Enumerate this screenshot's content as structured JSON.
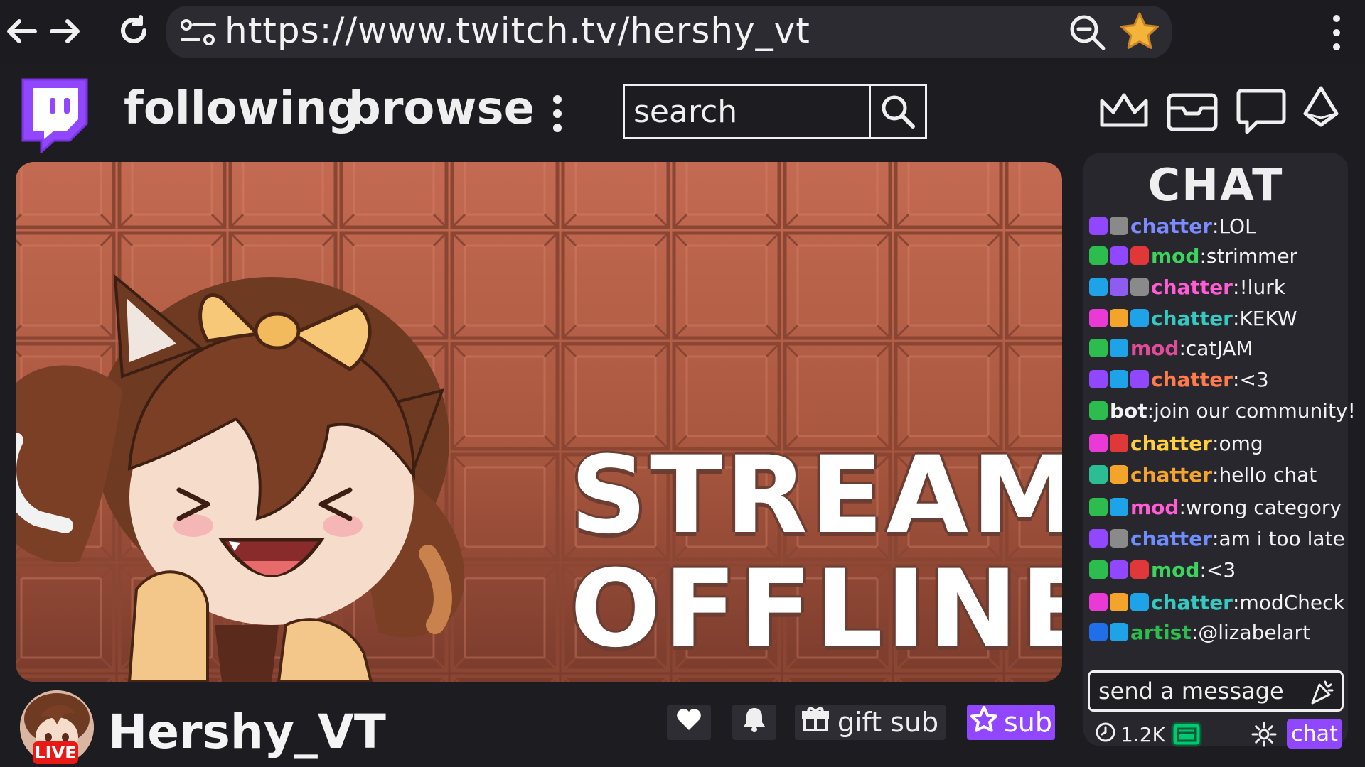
{
  "browser": {
    "url": "https://www.twitch.tv/hershy_vt",
    "icons": [
      "back-icon",
      "forward-icon",
      "reload-icon",
      "site-settings-icon",
      "zoom-out-icon",
      "bookmark-star-icon",
      "browser-menu-icon"
    ],
    "star_color": "#f4b43a"
  },
  "header": {
    "nav": [
      "following",
      "browse"
    ],
    "search_placeholder": "search",
    "icons": [
      "crown-icon",
      "inbox-icon",
      "whispers-icon",
      "bits-icon"
    ],
    "brand_color": "#9146ff"
  },
  "player": {
    "status_line1": "STREAM",
    "status_line2": "OFFLINE"
  },
  "channel": {
    "name": "Hershy_VT",
    "live_badge": "LIVE",
    "gift_label": "gift sub",
    "sub_label": "sub"
  },
  "chat": {
    "title": "CHAT",
    "messages": [
      {
        "badges": [
          "#9146ff",
          "#8a8a8a"
        ],
        "name": "chatter",
        "color": "#7c8cff",
        "text": "LOL"
      },
      {
        "badges": [
          "#2dbd4e",
          "#9146ff",
          "#e03838"
        ],
        "name": "mod",
        "color": "#3dd45e",
        "text": "strimmer"
      },
      {
        "badges": [
          "#1fa3e8",
          "#8e5cf0",
          "#8a8a8a"
        ],
        "name": "chatter",
        "color": "#ff5cd6",
        "text": "!lurk"
      },
      {
        "badges": [
          "#e93ad6",
          "#f4a32b",
          "#1fa3e8"
        ],
        "name": "chatter",
        "color": "#35c9c2",
        "text": "KEKW"
      },
      {
        "badges": [
          "#2dbd4e",
          "#1fa3e8"
        ],
        "name": "mod",
        "color": "#e04c9a",
        "text": "catJAM"
      },
      {
        "badges": [
          "#9146ff",
          "#1fa3e8",
          "#9146ff"
        ],
        "name": "chatter",
        "color": "#ff7a4d",
        "text": "<3"
      },
      {
        "badges": [
          "#2dbd4e"
        ],
        "name": "bot",
        "color": "#f2f2f2",
        "text": "join our community!"
      },
      {
        "badges": [
          "#e93ad6",
          "#e03838"
        ],
        "name": "chatter",
        "color": "#ffcf3d",
        "text": "omg"
      },
      {
        "badges": [
          "#2dbd94",
          "#f4a32b"
        ],
        "name": "chatter",
        "color": "#f4a32b",
        "text": "hello chat"
      },
      {
        "badges": [
          "#2dbd4e",
          "#1fa3e8"
        ],
        "name": "mod",
        "color": "#ff5cd6",
        "text": "wrong category"
      },
      {
        "badges": [
          "#9146ff",
          "#8a8a8a"
        ],
        "name": "chatter",
        "color": "#6f8dff",
        "text": "am i too late"
      },
      {
        "badges": [
          "#2dbd4e",
          "#9146ff",
          "#e03838"
        ],
        "name": "mod",
        "color": "#3dd45e",
        "text": "<3"
      },
      {
        "badges": [
          "#e93ad6",
          "#f4a32b",
          "#1fa3e8"
        ],
        "name": "chatter",
        "color": "#35c9c2",
        "text": "modCheck"
      },
      {
        "badges": [
          "#1f6fe8",
          "#1fa3e8"
        ],
        "name": "artist",
        "color": "#2dbd4e",
        "text": "@lizabelart"
      }
    ],
    "input_placeholder": "send a message",
    "viewer_count": "1.2K",
    "chat_button": "chat"
  }
}
